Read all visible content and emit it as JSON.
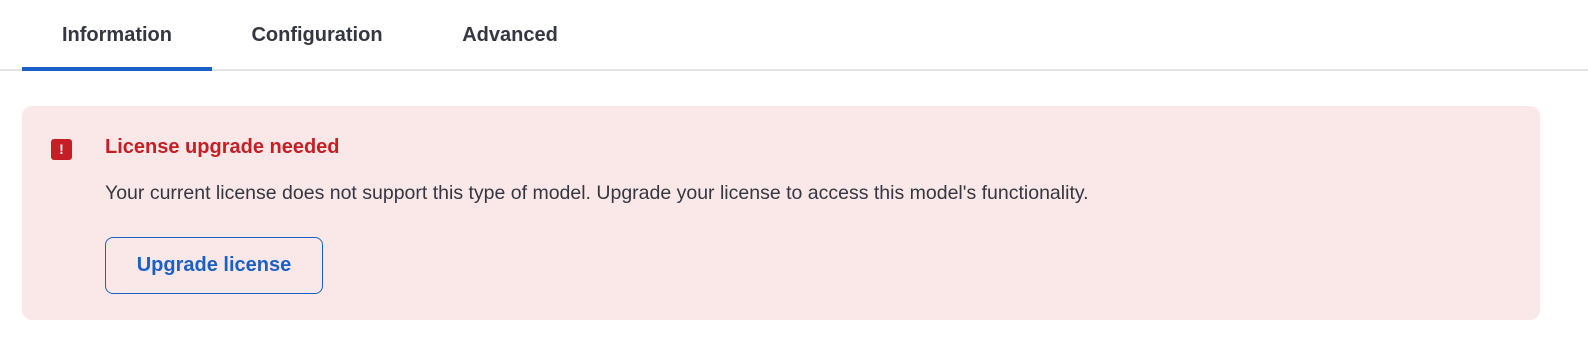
{
  "tabs": [
    {
      "label": "Information",
      "selected": true
    },
    {
      "label": "Configuration",
      "selected": false
    },
    {
      "label": "Advanced",
      "selected": false
    }
  ],
  "callout": {
    "icon": "alert-icon",
    "icon_glyph": "!",
    "title": "License upgrade needed",
    "body": "Your current license does not support this type of model. Upgrade your license to access this model's functionality.",
    "button_label": "Upgrade license"
  },
  "colors": {
    "accent": "#1961c7",
    "danger": "#c61e25",
    "callout_background": "#fae8e8"
  }
}
